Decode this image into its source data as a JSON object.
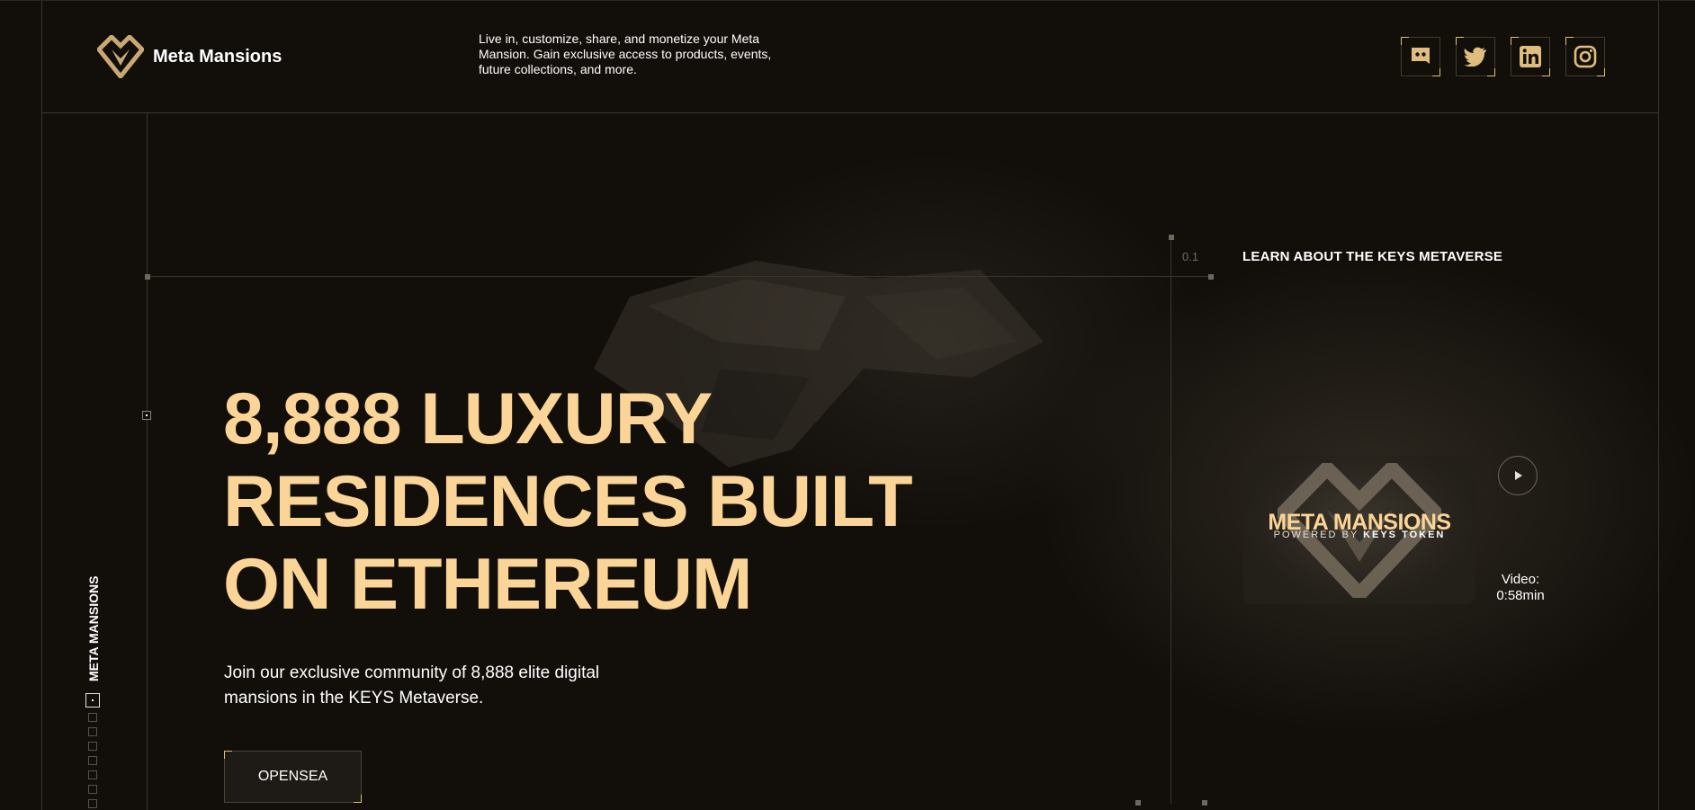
{
  "brand": {
    "name": "Meta Mansions",
    "accent": "#fbd597"
  },
  "header": {
    "tagline": "Live in, customize, share, and monetize your Meta Mansion. Gain exclusive access to products, events, future collections, and more."
  },
  "socials": [
    {
      "name": "discord",
      "icon": "discord-icon"
    },
    {
      "name": "twitter",
      "icon": "twitter-icon"
    },
    {
      "name": "linkedin",
      "icon": "linkedin-icon"
    },
    {
      "name": "instagram",
      "icon": "instagram-icon"
    }
  ],
  "hero": {
    "title_lines": [
      "8,888 LUXURY",
      "RESIDENCES BUILT",
      "ON ETHEREUM"
    ],
    "subtitle": "Join our exclusive community of 8,888 elite digital mansions in the KEYS Metaverse.",
    "cta_label": "OPENSEA"
  },
  "side": {
    "vertical_label": "META MANSIONS",
    "pager_count": 8,
    "pager_active": 0
  },
  "scale_label": "0.1",
  "learn_link": "LEARN ABOUT THE KEYS METAVERSE",
  "video": {
    "thumb_title": "META MANSIONS",
    "thumb_sub_prefix": "POWERED BY",
    "thumb_sub_bold": "KEYS TOKEN",
    "label": "Video:",
    "duration": "0:58min"
  }
}
